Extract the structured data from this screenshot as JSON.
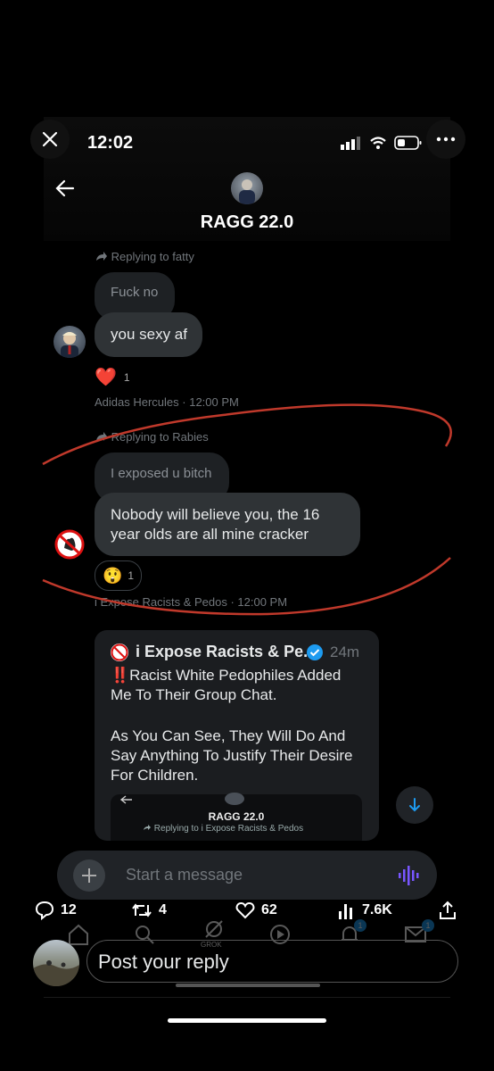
{
  "status_bar": {
    "time": "12:02"
  },
  "header": {
    "title": "RAGG 22.0"
  },
  "messages": [
    {
      "reply_to": "Replying to fatty",
      "quoted": "Fuck no",
      "text": "you sexy af",
      "reaction": {
        "emoji": "❤️",
        "count": "1"
      },
      "meta": "Adidas Hercules · 12:00 PM"
    },
    {
      "reply_to": "Replying to Rabies",
      "quoted": "I exposed u bitch",
      "text": "Nobody will believe you, the 16 year olds are all mine cracker",
      "text_lines": [
        "Nobody will believe you, the 16",
        "year olds are all mine cracker"
      ],
      "reaction": {
        "emoji": "😲",
        "count": "1"
      },
      "meta": "i Expose Racists & Pedos · 12:00 PM"
    }
  ],
  "quote_card": {
    "author": "i Expose Racists & Pe...",
    "time": "24m",
    "lines": [
      "‼️Racist White Pedophiles Added",
      "Me To Their Group Chat.",
      "",
      "As You Can See, They Will Do And",
      "Say Anything To Justify Their Desire",
      "For Children."
    ],
    "embedded_title": "RAGG 22.0",
    "embedded_reply": "Replying to i Expose Racists & Pedos"
  },
  "composer": {
    "placeholder": "Start a message"
  },
  "stats": {
    "replies": "12",
    "reposts": "4",
    "likes": "62",
    "views": "7.6K"
  },
  "nav": {
    "grok_label": "GROK",
    "notif_badge": "1",
    "msg_badge": "1"
  },
  "reply_bar": {
    "placeholder": "Post your reply"
  },
  "colors": {
    "accent": "#1d9bf0",
    "bubble": "#2f3336",
    "annotation": "#c0392b"
  }
}
